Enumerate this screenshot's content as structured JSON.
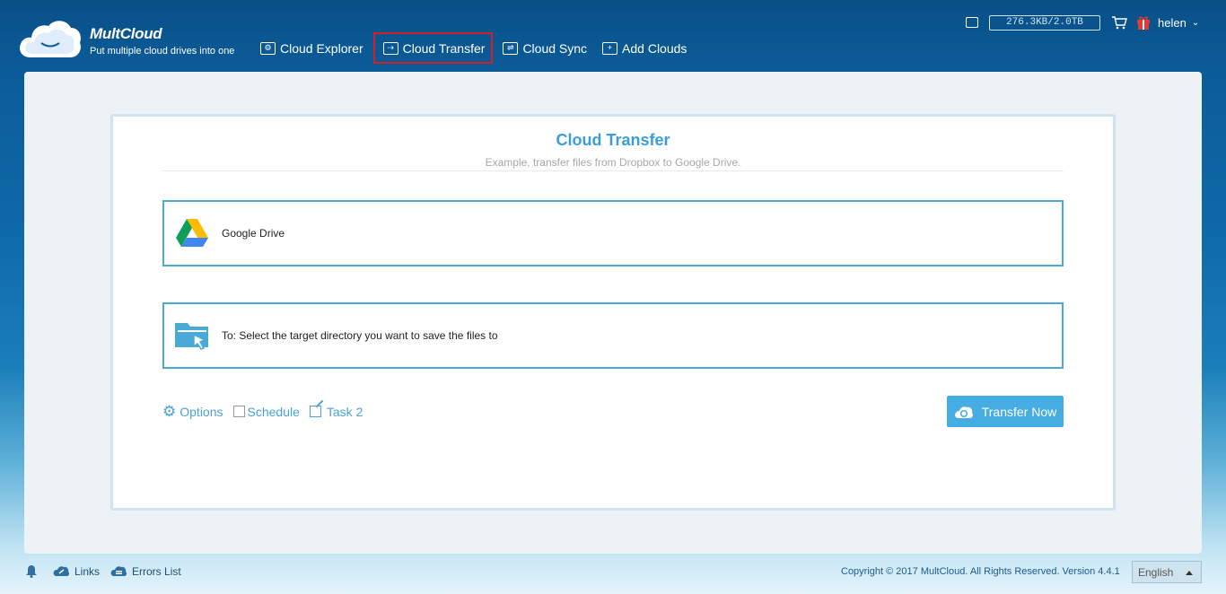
{
  "app": {
    "brand_name": "MultCloud",
    "tagline": "Put multiple cloud drives into one"
  },
  "nav": {
    "items": [
      {
        "label": "Cloud Explorer",
        "icon": "explorer-icon"
      },
      {
        "label": "Cloud Transfer",
        "icon": "transfer-icon",
        "active": true
      },
      {
        "label": "Cloud Sync",
        "icon": "sync-icon"
      },
      {
        "label": "Add Clouds",
        "icon": "add-icon"
      }
    ]
  },
  "topbar": {
    "quota": "276.3KB/2.0TB",
    "username": "helen"
  },
  "transfer": {
    "title": "Cloud Transfer",
    "subtitle": "Example, transfer files from Dropbox to Google Drive.",
    "source_label": "Google Drive",
    "target_label": "To: Select the target directory you want to save the files to",
    "options_label": "Options",
    "schedule_label": "Schedule",
    "task_label": "Task 2",
    "button_label": "Transfer Now"
  },
  "footer": {
    "links_label": "Links",
    "errors_label": "Errors List",
    "copyright": "Copyright © 2017 MultCloud. All Rights Reserved. Version 4.4.1",
    "language": "English"
  },
  "colors": {
    "accent": "#45ade2",
    "header_bg": "#0b5c99",
    "active_outline": "#d32027"
  }
}
